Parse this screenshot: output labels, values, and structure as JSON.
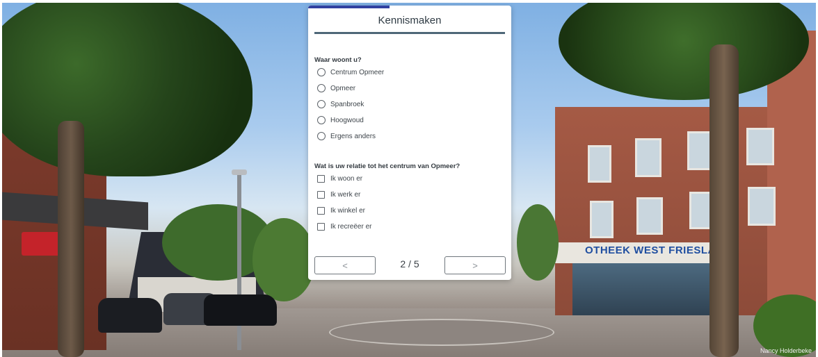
{
  "card": {
    "title": "Kennismaken",
    "progress_fraction": 0.4,
    "question1": {
      "label": "Waar woont u?",
      "options": [
        "Centrum Opmeer",
        "Opmeer",
        "Spanbroek",
        "Hoogwoud",
        "Ergens anders"
      ]
    },
    "question2": {
      "label": "Wat is uw relatie tot het centrum van Opmeer?",
      "options": [
        "Ik woon er",
        "Ik werk er",
        "Ik winkel er",
        "Ik recreëer er"
      ]
    },
    "nav": {
      "prev_symbol": "<",
      "next_symbol": ">",
      "page_indicator": "2 / 5"
    }
  },
  "background": {
    "sign_text": "OTHEEK WEST FRIESLAND",
    "credit": "Nancy Holderbeke"
  },
  "colors": {
    "accent": "#3140a0",
    "rule": "#4e6778"
  }
}
